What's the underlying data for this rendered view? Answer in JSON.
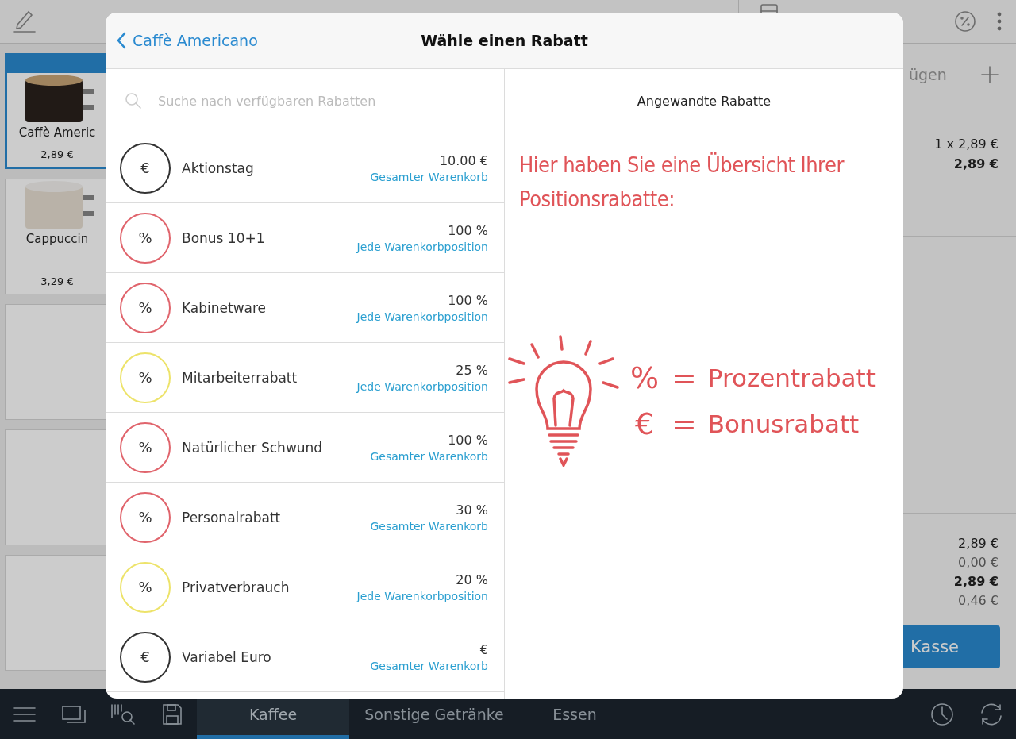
{
  "products": [
    {
      "kind": "product",
      "name": "Caffè Americ",
      "price": "2,89 €",
      "selected": true
    },
    {
      "kind": "product",
      "name": "Cappuccin",
      "price": "3,29 €",
      "selected": false
    },
    {
      "kind": "empty",
      "selected": false
    },
    {
      "kind": "empty",
      "selected": false
    },
    {
      "kind": "empty",
      "selected": false
    }
  ],
  "cart": {
    "add_label": "ügen",
    "item": {
      "quantity_price": "1 x 2,89 €",
      "total": "2,89 €"
    },
    "totals": [
      {
        "value": "2,89 €",
        "kind": "normal"
      },
      {
        "value": "0,00 €",
        "kind": "muted"
      },
      {
        "value": "2,89 €",
        "kind": "bold"
      },
      {
        "value": "0,46 €",
        "kind": "muted"
      }
    ],
    "checkout_label": "Kasse"
  },
  "bottom_nav": {
    "tabs": [
      {
        "label": "Kaffee",
        "selected": true
      },
      {
        "label": "Sonstige Getränke",
        "selected": false
      },
      {
        "label": "Essen",
        "selected": false
      }
    ]
  },
  "modal": {
    "back_label": "Caffè Americano",
    "title": "Wähle einen Rabatt",
    "search": {
      "placeholder": "Suche nach verfügbaren Rabatten"
    },
    "discounts": [
      {
        "symbol": "€",
        "color": "#333333",
        "name": "Aktionstag",
        "amount": "10.00 €",
        "scope": "Gesamter Warenkorb"
      },
      {
        "symbol": "%",
        "color": "#e0646c",
        "name": "Bonus 10+1",
        "amount": "100 %",
        "scope": "Jede Warenkorbposition"
      },
      {
        "symbol": "%",
        "color": "#e0646c",
        "name": "Kabinetware",
        "amount": "100 %",
        "scope": "Jede Warenkorbposition"
      },
      {
        "symbol": "%",
        "color": "#ede36a",
        "name": "Mitarbeiterrabatt",
        "amount": "25 %",
        "scope": "Jede Warenkorbposition"
      },
      {
        "symbol": "%",
        "color": "#e0646c",
        "name": "Natürlicher Schwund",
        "amount": "100 %",
        "scope": "Gesamter Warenkorb"
      },
      {
        "symbol": "%",
        "color": "#e0646c",
        "name": "Personalrabatt",
        "amount": "30 %",
        "scope": "Gesamter Warenkorb"
      },
      {
        "symbol": "%",
        "color": "#ede36a",
        "name": "Privatverbrauch",
        "amount": "20 %",
        "scope": "Jede Warenkorbposition"
      },
      {
        "symbol": "€",
        "color": "#333333",
        "name": "Variabel Euro",
        "amount": "€",
        "scope": "Gesamter Warenkorb"
      }
    ],
    "applied": {
      "header": "Angewandte Rabatte",
      "note": "Hier haben Sie eine Übersicht Ihrer Positionsrabatte:",
      "legend": [
        {
          "symbol": "%",
          "equals": "=",
          "label": "Prozentrabatt"
        },
        {
          "symbol": "€",
          "equals": "=",
          "label": "Bonusrabatt"
        }
      ]
    }
  }
}
